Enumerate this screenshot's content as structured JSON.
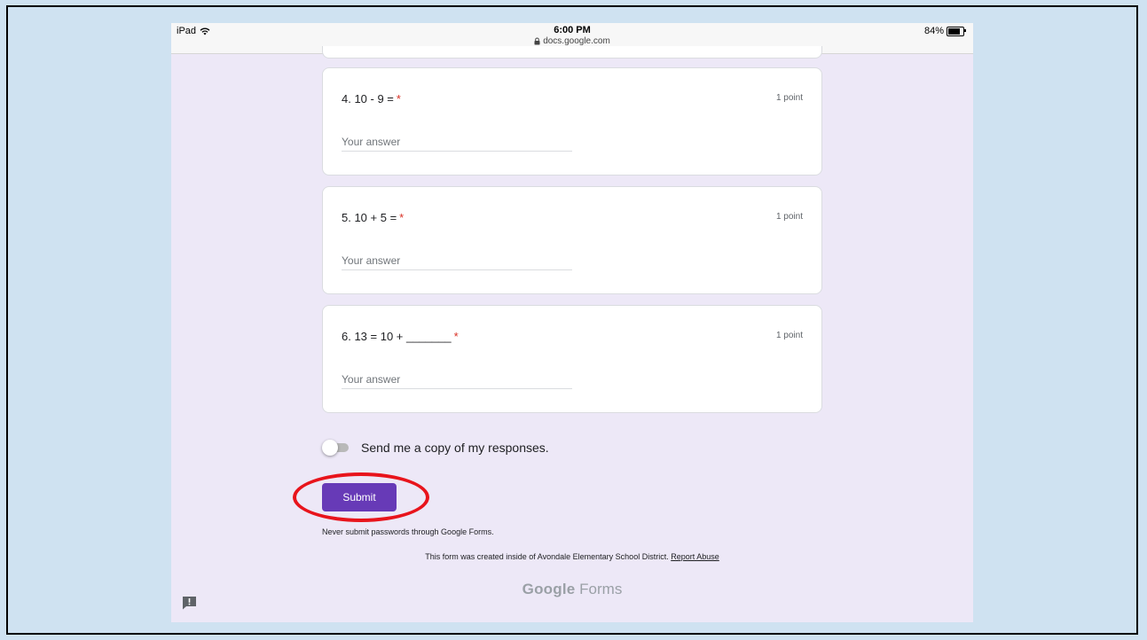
{
  "status_bar": {
    "device": "iPad",
    "time": "6:00 PM",
    "url": "docs.google.com",
    "battery": "84%",
    "battery_fraction": 0.84
  },
  "questions": [
    {
      "title": "4. 10 - 9 =",
      "required_mark": "*",
      "points": "1 point",
      "placeholder": "Your answer",
      "value": ""
    },
    {
      "title": "5. 10 + 5 =",
      "required_mark": "*",
      "points": "1 point",
      "placeholder": "Your answer",
      "value": ""
    },
    {
      "title": "6. 13 = 10 + _______",
      "required_mark": "*",
      "points": "1 point",
      "placeholder": "Your answer",
      "value": ""
    }
  ],
  "copy_toggle": {
    "label": "Send me a copy of my responses.",
    "on": false
  },
  "submit_label": "Submit",
  "footer": {
    "warning": "Never submit passwords through Google Forms.",
    "created": "This form was created inside of Avondale Elementary School District.",
    "report_link": "Report Abuse",
    "logo_google": "Google",
    "logo_forms": "Forms"
  },
  "colors": {
    "accent": "#673ab7",
    "required": "#d93025",
    "annotation_circle": "#e8141c",
    "form_background": "#ede8f7",
    "slide_background": "#cfe2f1"
  },
  "icons": [
    "wifi-icon",
    "lock-icon",
    "battery-icon",
    "feedback-icon"
  ]
}
